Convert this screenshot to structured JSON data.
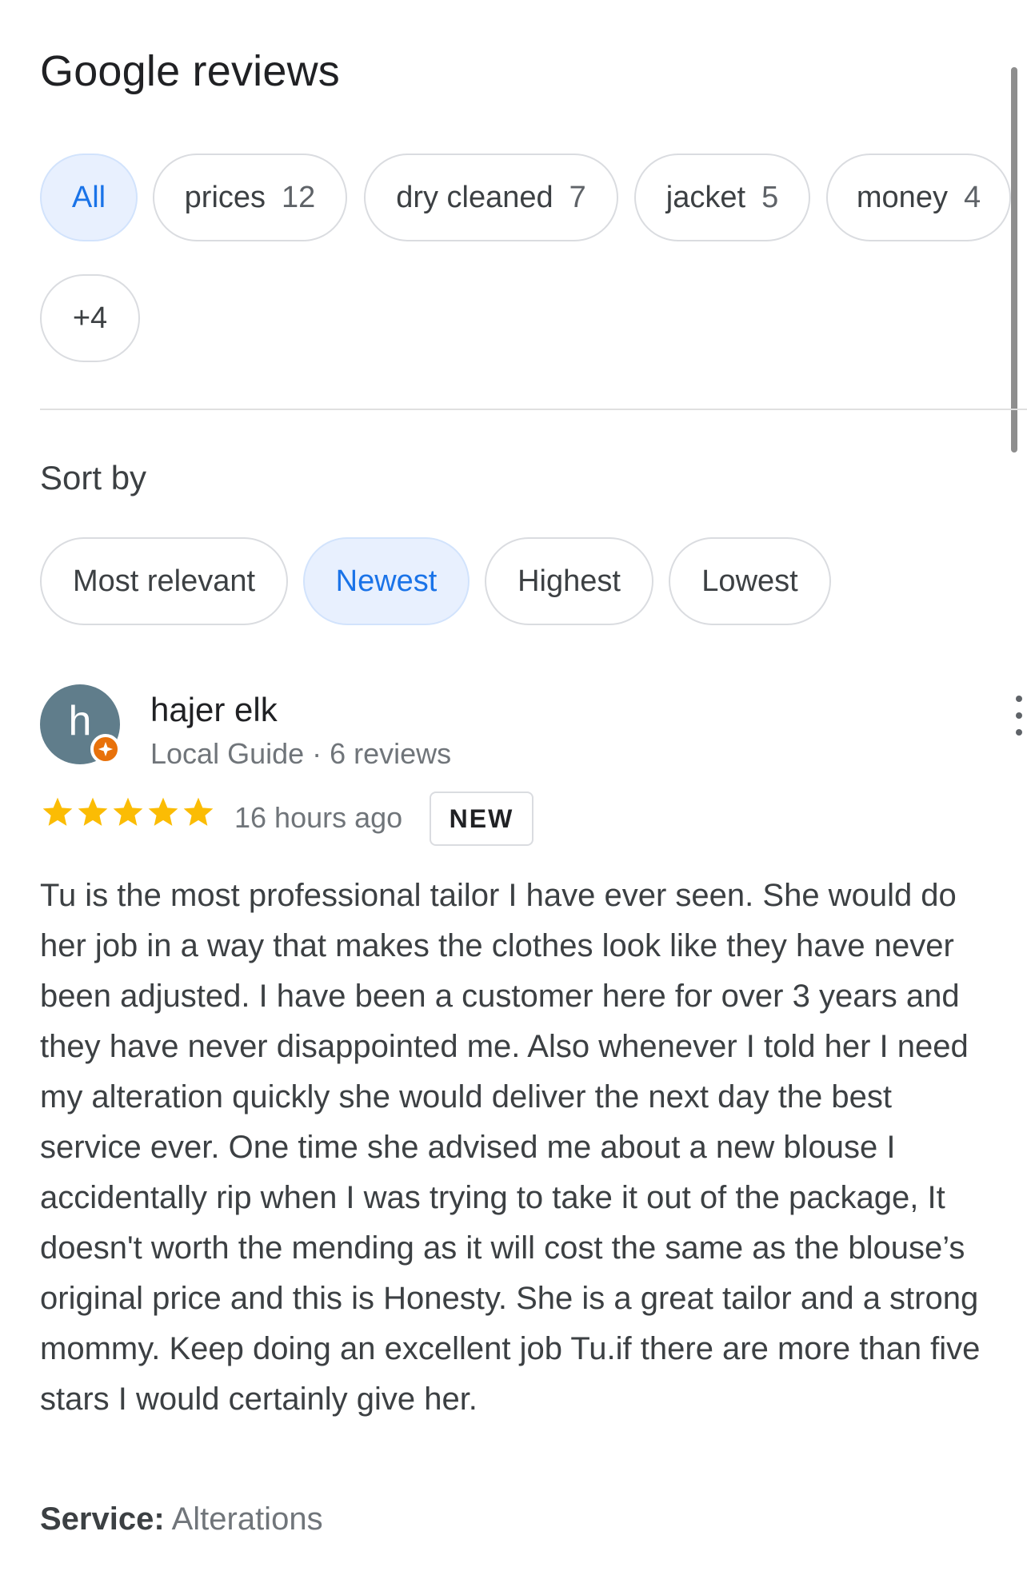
{
  "header": {
    "title": "Google reviews"
  },
  "topics": [
    {
      "label": "All",
      "count": "",
      "selected": true
    },
    {
      "label": "prices",
      "count": "12"
    },
    {
      "label": "dry cleaned",
      "count": "7"
    },
    {
      "label": "jacket",
      "count": "5"
    },
    {
      "label": "money",
      "count": "4"
    },
    {
      "label": "+4",
      "count": ""
    }
  ],
  "sort": {
    "label": "Sort by",
    "options": [
      {
        "label": "Most relevant"
      },
      {
        "label": "Newest",
        "selected": true
      },
      {
        "label": "Highest"
      },
      {
        "label": "Lowest"
      }
    ]
  },
  "review": {
    "avatar_letter": "h",
    "avatar_color": "#607d8b",
    "name": "hajer elk",
    "meta": "Local Guide · 6 reviews",
    "rating": 5,
    "time": "16 hours ago",
    "badge": "NEW",
    "text": "Tu is the most professional tailor I have ever seen. She would do her job in a way that makes the clothes look like they have never been adjusted. I have been a customer here for over 3 years and they have never disappointed me. Also whenever I told her I need my alteration quickly she would deliver the next day the best service ever. One time she advised me about a new blouse I accidentally rip when I was trying to take it out of the package, It doesn't worth the mending as it will cost the same as the blouse’s original price and this is Honesty. She is a great tailor and a strong mommy. Keep doing an excellent job Tu.if there are more than five stars I would certainly give her.",
    "service_label": "Service:",
    "service_value": "Alterations"
  },
  "icons": [
    "star-icon",
    "local-guide-icon",
    "more-vert-icon"
  ],
  "colors": {
    "accent": "#1a73e8",
    "selected_bg": "#e8f0fe",
    "star": "#fbbc04",
    "guide_badge": "#e8710a"
  }
}
